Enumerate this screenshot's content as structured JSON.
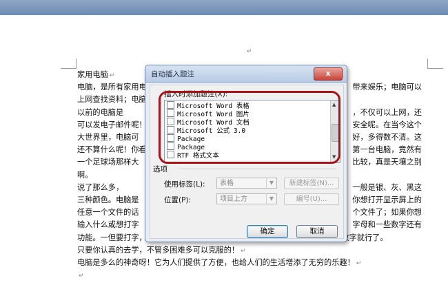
{
  "document": {
    "paragraph_mark": "↵",
    "lines": [
      {
        "text": "家用电脑",
        "end_mark": true
      },
      {
        "text": "电脑，是所有家用电",
        "right": "带来娱乐；电脑可以"
      },
      {
        "text": "上网查找资料；电脑",
        "right": ""
      },
      {
        "text": "    以前的电脑是",
        "right": "，不仅可以上网，还"
      },
      {
        "text": "可以发电子邮件呢！",
        "right": "安全呢。在当今这个"
      },
      {
        "text": "大世界里，电脑可",
        "right": "好，多得数不清。这"
      },
      {
        "text": "还不算什么呢！你看",
        "right": "第一台电脑，竟然有"
      },
      {
        "text": "一个足球场那样大",
        "right": "比较，真是天壤之别"
      },
      {
        "text": "啊。",
        "right": ""
      },
      {
        "text": "    说了那么多，",
        "right": "一般是银、灰、黑这"
      },
      {
        "text": "三种颜色。电脑是",
        "right": "你想打开显示屏上的"
      },
      {
        "text": "任意一个文件的话",
        "right": "个文件了；如果你想"
      },
      {
        "text": "输入什么或想打字",
        "right": "字母和一些数字还有"
      },
      {
        "text": "功能。一但要打字，你就按那26个英文字母，需要数字的话就按你需要的那个数字就行了。",
        "right": ""
      },
      {
        "text": "只要你认真的去学，不管多困难多可以克服的！",
        "end_mark": true
      },
      {
        "text": "    电脑是多么的神奇呀！它为人们提供了方便，也给人们的生活增添了无穷的乐趣！",
        "end_mark": true
      },
      {
        "text": "",
        "end_mark": true
      }
    ]
  },
  "dialog": {
    "title": "自动插入题注",
    "close_label": "x",
    "list_label": "插入时添加题注(X):",
    "list_items": [
      "Microsoft Word 表格",
      "Microsoft Word 图片",
      "Microsoft Word 文档",
      "Microsoft 公式 3.0",
      "Package",
      "Package",
      "RTF 格式文本"
    ],
    "options_label": "选项",
    "use_label_label": "使用标签(L):",
    "use_label_value": "表格",
    "position_label": "位置(P):",
    "position_value": "项目上方",
    "new_label_button": "新建标签(N)...",
    "numbering_button": "编号(U)...",
    "ok_button": "确定",
    "cancel_button": "取消"
  },
  "colors": {
    "highlight": "#a8121b",
    "title_bar": "#b9cce5",
    "close_button": "#c9443a"
  }
}
